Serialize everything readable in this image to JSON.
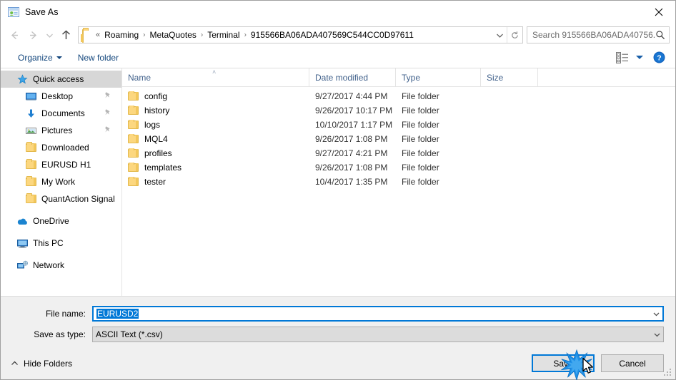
{
  "window": {
    "title": "Save As",
    "title_icon": "save-as-icon",
    "close_icon": "close-icon"
  },
  "nav": {
    "back_icon": "arrow-left-icon",
    "forward_icon": "arrow-right-icon",
    "recent_icon": "chevron-down-icon",
    "up_icon": "arrow-up-icon",
    "folder_icon": "folder-icon",
    "overflow": "«",
    "breadcrumbs": [
      "Roaming",
      "MetaQuotes",
      "Terminal",
      "915566BA06ADA407569C544CC0D97611"
    ],
    "separator": "›",
    "dropdown_icon": "chevron-down-icon",
    "refresh_icon": "refresh-icon"
  },
  "search": {
    "placeholder": "Search 915566BA06ADA40756...",
    "icon": "search-icon"
  },
  "toolbar": {
    "organize_label": "Organize",
    "new_folder_label": "New folder",
    "view_icon": "list-view-icon",
    "view_dropdown_icon": "chevron-down-icon",
    "help_icon": "help-icon"
  },
  "sidebar": {
    "items": [
      {
        "label": "Quick access",
        "icon": "star-icon",
        "selected": true,
        "indent": false,
        "pinned": false
      },
      {
        "label": "Desktop",
        "icon": "desktop-icon",
        "selected": false,
        "indent": true,
        "pinned": true
      },
      {
        "label": "Documents",
        "icon": "documents-icon",
        "selected": false,
        "indent": true,
        "pinned": true
      },
      {
        "label": "Pictures",
        "icon": "pictures-icon",
        "selected": false,
        "indent": true,
        "pinned": true
      },
      {
        "label": "Downloaded",
        "icon": "folder-icon",
        "selected": false,
        "indent": true,
        "pinned": false
      },
      {
        "label": "EURUSD H1",
        "icon": "folder-icon",
        "selected": false,
        "indent": true,
        "pinned": false
      },
      {
        "label": "My Work",
        "icon": "folder-icon",
        "selected": false,
        "indent": true,
        "pinned": false
      },
      {
        "label": "QuantAction Signal",
        "icon": "folder-icon",
        "selected": false,
        "indent": true,
        "pinned": false
      },
      {
        "label": "OneDrive",
        "icon": "onedrive-icon",
        "selected": false,
        "indent": false,
        "pinned": false,
        "gap_before": true
      },
      {
        "label": "This PC",
        "icon": "this-pc-icon",
        "selected": false,
        "indent": false,
        "pinned": false,
        "gap_before": true
      },
      {
        "label": "Network",
        "icon": "network-icon",
        "selected": false,
        "indent": false,
        "pinned": false,
        "gap_before": true
      }
    ]
  },
  "filelist": {
    "columns": [
      "Name",
      "Date modified",
      "Type",
      "Size"
    ],
    "sort_caret": "˄",
    "rows": [
      {
        "name": "config",
        "date": "9/27/2017 4:44 PM",
        "type": "File folder",
        "size": ""
      },
      {
        "name": "history",
        "date": "9/26/2017 10:17 PM",
        "type": "File folder",
        "size": ""
      },
      {
        "name": "logs",
        "date": "10/10/2017 1:17 PM",
        "type": "File folder",
        "size": ""
      },
      {
        "name": "MQL4",
        "date": "9/26/2017 1:08 PM",
        "type": "File folder",
        "size": ""
      },
      {
        "name": "profiles",
        "date": "9/27/2017 4:21 PM",
        "type": "File folder",
        "size": ""
      },
      {
        "name": "templates",
        "date": "9/26/2017 1:08 PM",
        "type": "File folder",
        "size": ""
      },
      {
        "name": "tester",
        "date": "10/4/2017 1:35 PM",
        "type": "File folder",
        "size": ""
      }
    ]
  },
  "form": {
    "filename_label": "File name:",
    "filename_value": "EURUSD2",
    "filetype_label": "Save as type:",
    "filetype_value": "ASCII Text (*.csv)",
    "dropdown_icon": "chevron-down-icon"
  },
  "footer": {
    "hide_folders_label": "Hide Folders",
    "hide_folders_icon": "chevron-up-icon",
    "save_label": "Save",
    "cancel_label": "Cancel",
    "resize_grip_icon": "resize-grip-icon"
  },
  "pointer": {
    "click_burst_icon": "click-burst-icon",
    "cursor_icon": "mouse-cursor-icon"
  },
  "colors": {
    "accent": "#0078d7",
    "folder": "#fcd77f",
    "link": "#14477d",
    "header_text": "#41618b",
    "selection": "#0078d7"
  }
}
